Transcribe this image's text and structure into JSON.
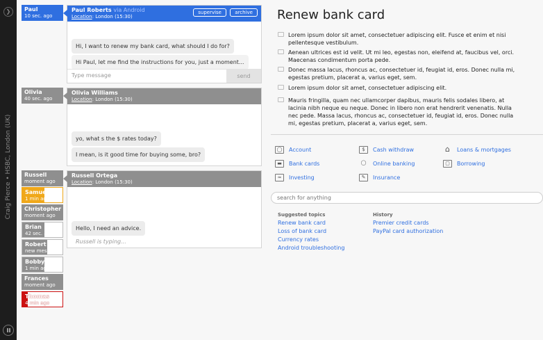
{
  "sidebar": {
    "vertical_text": "Craig Pierce • HSBC, London (UK)"
  },
  "sessions": [
    {
      "name": "Paul",
      "time": "10 sec. ago"
    },
    {
      "name": "Olivia",
      "time": "40 sec. ago"
    },
    {
      "name": "Russell",
      "time": "moment ago"
    },
    {
      "name": "Samuel",
      "time": "1 min ago"
    },
    {
      "name": "Christopher",
      "time": "moment ago"
    },
    {
      "name": "Brian",
      "time": "42 sec. ago"
    },
    {
      "name": "Robert",
      "time": "new message"
    },
    {
      "name": "Bobby",
      "time": "1 min ago"
    },
    {
      "name": "Frances",
      "time": "moment ago"
    },
    {
      "name": "Thomas",
      "time": "4 min ago"
    }
  ],
  "chats": [
    {
      "title": "Paul Roberts",
      "via": "via Android",
      "location_label": "Location",
      "location": ": London (15:30)",
      "supervise": "supervise",
      "archive": "archive",
      "messages": [
        "Hi, I want to renew my bank card, what should I do for?",
        "Hi Paul, let me find the instructions for you, just a moment..."
      ],
      "input_placeholder": "Type message",
      "send": "send"
    },
    {
      "title": "Olivia Williams",
      "location_label": "Location",
      "location": ": London (15:30)",
      "messages": [
        "yo, what s the $ rates today?",
        "I mean, is it good time for buying some, bro?"
      ]
    },
    {
      "title": "Russell Ortega",
      "location_label": "Location",
      "location": ": London (15:30)",
      "messages": [
        "Hello, I need an advice."
      ],
      "typing": "Russell is typing..."
    }
  ],
  "article": {
    "title": "Renew bank card",
    "paragraphs": [
      "Lorem ipsum dolor sit amet, consectetuer adipiscing elit. Fusce et enim et nisi pellentesque vestibulum.",
      "Aenean ultrices est id velit. Ut mi leo, egestas non, eleifend at, faucibus vel, orci. Maecenas condimentum porta pede.",
      "Donec massa lacus, rhoncus ac, consectetuer id, feugiat id, eros. Donec nulla mi, egestas pretium, placerat a, varius eget, sem.",
      "Lorem ipsum dolor sit amet, consectetuer adipiscing elit.",
      "Mauris fringilla, quam nec ullamcorper dapibus, mauris felis sodales libero, at lacinia nibh neque eu neque. Donec in libero non erat hendrerit venenatis. Nulla nec pede. Massa lacus, rhoncus ac, consectetuer id, feugiat id, eros. Donec nulla mi, egestas pretium, placerat a, varius eget, sem."
    ]
  },
  "categories": [
    {
      "label": "Account",
      "icon": "account-icon"
    },
    {
      "label": "Cash withdraw",
      "icon": "cash-icon"
    },
    {
      "label": "Loans & mortgages",
      "icon": "house-icon"
    },
    {
      "label": "Bank cards",
      "icon": "card-icon"
    },
    {
      "label": "Online banking",
      "icon": "mouse-icon"
    },
    {
      "label": "Borrowing",
      "icon": "wallet-icon"
    },
    {
      "label": "Investing",
      "icon": "chart-icon"
    },
    {
      "label": "Insurance",
      "icon": "document-icon"
    }
  ],
  "search": {
    "placeholder": "search for anything"
  },
  "suggested": {
    "title": "Suggested topics",
    "items": [
      "Renew bank card",
      "Loss of bank card",
      "Currency rates",
      "Android troubleshooting"
    ]
  },
  "history": {
    "title": "History",
    "items": [
      "Premier credit cards",
      "PayPal card authorization"
    ]
  }
}
